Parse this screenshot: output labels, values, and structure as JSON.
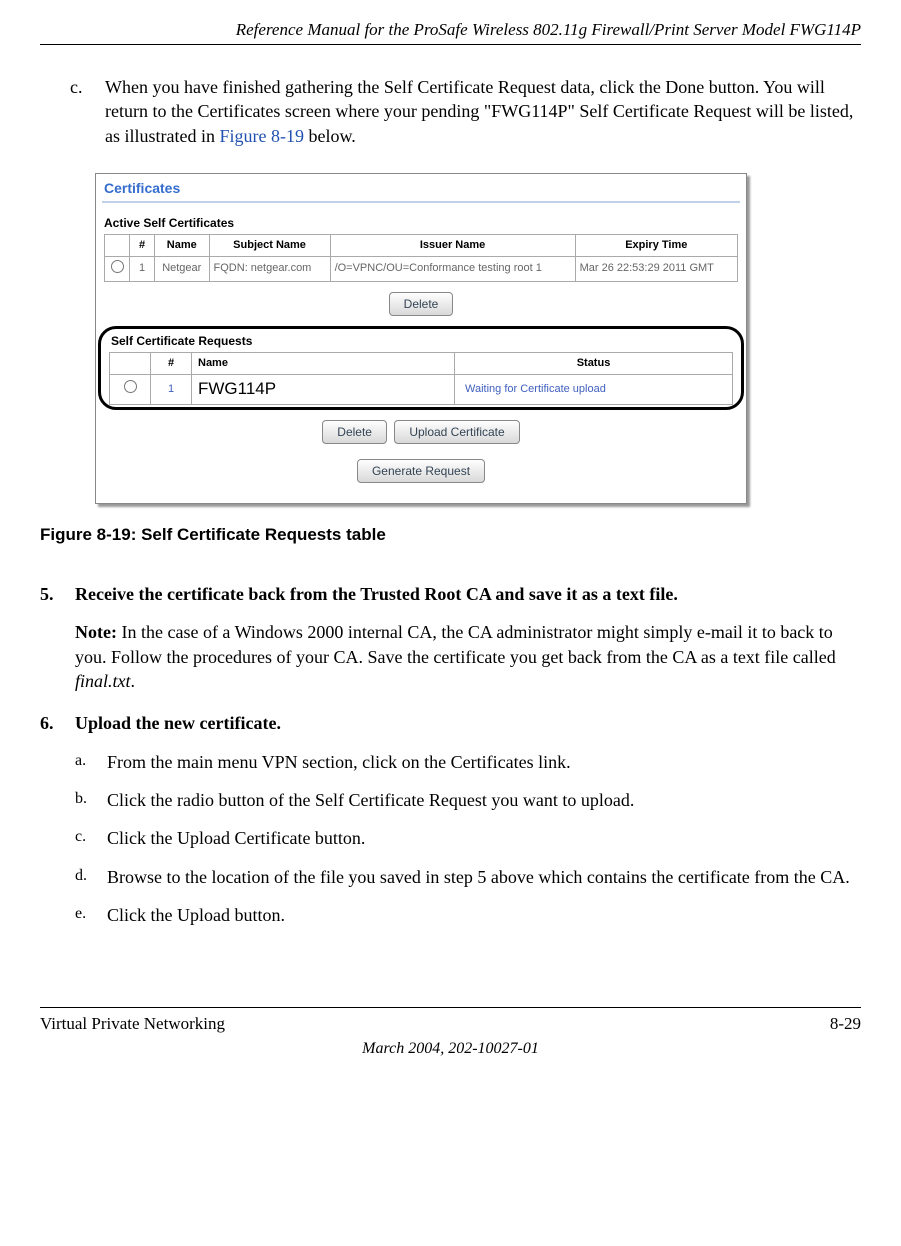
{
  "header": "Reference Manual for the ProSafe Wireless 802.11g  Firewall/Print Server Model FWG114P",
  "item_c": {
    "marker": "c.",
    "text_before_link": "When you have finished gathering the Self Certificate Request data, click the Done button. You will return to the Certificates screen where your pending \"FWG114P\" Self Certificate Request will be listed, as illustrated in ",
    "link_text": "Figure 8-19",
    "text_after_link": " below."
  },
  "screenshot": {
    "title": "Certificates",
    "active_label": "Active Self Certificates",
    "active_headers": {
      "num": "#",
      "name": "Name",
      "subject": "Subject Name",
      "issuer": "Issuer Name",
      "expiry": "Expiry Time"
    },
    "active_row": {
      "num": "1",
      "name": "Netgear",
      "subject": "FQDN: netgear.com",
      "issuer": "/O=VPNC/OU=Conformance testing root 1",
      "expiry": "Mar 26 22:53:29 2011 GMT"
    },
    "delete_btn": "Delete",
    "requests_label": "Self Certificate Requests",
    "req_headers": {
      "num": "#",
      "name": "Name",
      "status": "Status"
    },
    "req_row": {
      "num": "1",
      "name_overlay": "FWG114P",
      "status": "Waiting for Certificate upload"
    },
    "upload_btn": "Upload Certificate",
    "generate_btn": "Generate Request"
  },
  "figure_caption": "Figure 8-19:  Self Certificate Requests table",
  "step5": {
    "num": "5.",
    "title": "Receive the certificate back from the Trusted Root CA and save it as a text file.",
    "note_label": "Note:",
    "note_text": " In the case of a Windows 2000 internal CA, the CA administrator might simply e-mail it to back to you. Follow the procedures of your CA. Save the certificate you get back from the CA as a text file called ",
    "note_italic": "final.txt",
    "note_end": "."
  },
  "step6": {
    "num": "6.",
    "title": "Upload the new certificate.",
    "a": {
      "marker": "a.",
      "text": "From the main menu VPN section, click on the Certificates link."
    },
    "b": {
      "marker": "b.",
      "text": "Click the radio button of the Self Certificate Request you want to upload."
    },
    "c": {
      "marker": "c.",
      "text": "Click the Upload Certificate button."
    },
    "d": {
      "marker": "d.",
      "text": "Browse to the location of the file you saved in step 5 above which contains the certificate from the CA."
    },
    "e": {
      "marker": "e.",
      "text": "Click the Upload button."
    }
  },
  "footer": {
    "left": "Virtual Private Networking",
    "right": "8-29",
    "center": "March 2004, 202-10027-01"
  }
}
